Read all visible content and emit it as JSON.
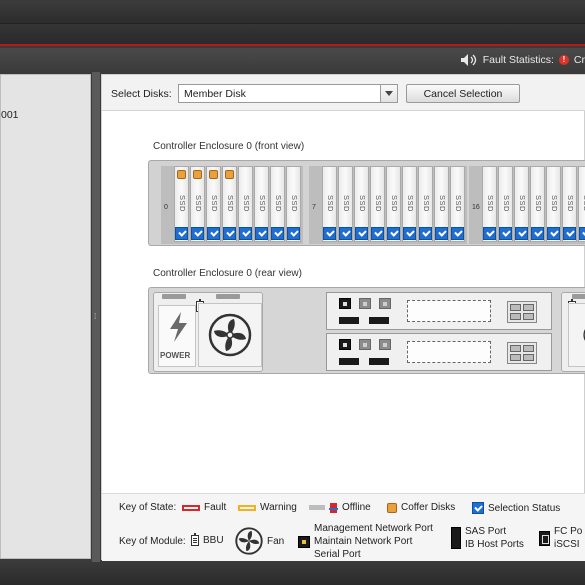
{
  "header": {
    "fault_statistics_label": "Fault Statistics:",
    "fault_statistics_value": "Cr"
  },
  "left_panel": {
    "tree_item_text": "001"
  },
  "toolbar": {
    "select_disks_label": "Select Disks:",
    "select_disks_value": "Member Disk",
    "cancel_selection_label": "Cancel Selection"
  },
  "front_view": {
    "title": "Controller Enclosure 0 (front view)",
    "groups": [
      {
        "start_index": "0",
        "slots": [
          "SSD",
          "SSD",
          "SSD",
          "SSD",
          "SSD",
          "SSD",
          "SSD",
          "SSD"
        ],
        "coffer_slots": [
          0,
          1,
          2,
          3
        ]
      },
      {
        "start_index": "7",
        "slots": [
          "SSD",
          "SSD",
          "SSD",
          "SSD",
          "SSD",
          "SSD",
          "SSD",
          "SSD",
          "SSD"
        ],
        "coffer_slots": []
      },
      {
        "start_index": "16",
        "slots": [
          "SSD",
          "SSD",
          "SSD",
          "SSD",
          "SSD",
          "SSD",
          "SSD"
        ],
        "coffer_slots": []
      }
    ]
  },
  "rear_view": {
    "title": "Controller Enclosure 0 (rear view)",
    "power_label": "POWER"
  },
  "legend": {
    "key_of_state_label": "Key of State:",
    "states": {
      "fault": "Fault",
      "warning": "Warning",
      "offline": "Offline",
      "coffer": "Coffer Disks",
      "selection": "Selection Status"
    },
    "key_of_module_label": "Key of Module:",
    "modules": {
      "bbu": "BBU",
      "fan": "Fan",
      "management_port": "Management Network Port",
      "maintain_port": "Maintain Network Port",
      "serial_port": "Serial Port",
      "sas_port": "SAS Port",
      "ib_port": "IB Host Ports",
      "fc_port": "FC Po",
      "iscsi_port": "iSCSI"
    }
  },
  "colors": {
    "selection_blue": "#1f6fd1",
    "coffer_orange": "#e9a23b",
    "fault_red": "#d7272c",
    "warning_yellow": "#f2b21d",
    "header_accent_red": "#b31b1b"
  }
}
